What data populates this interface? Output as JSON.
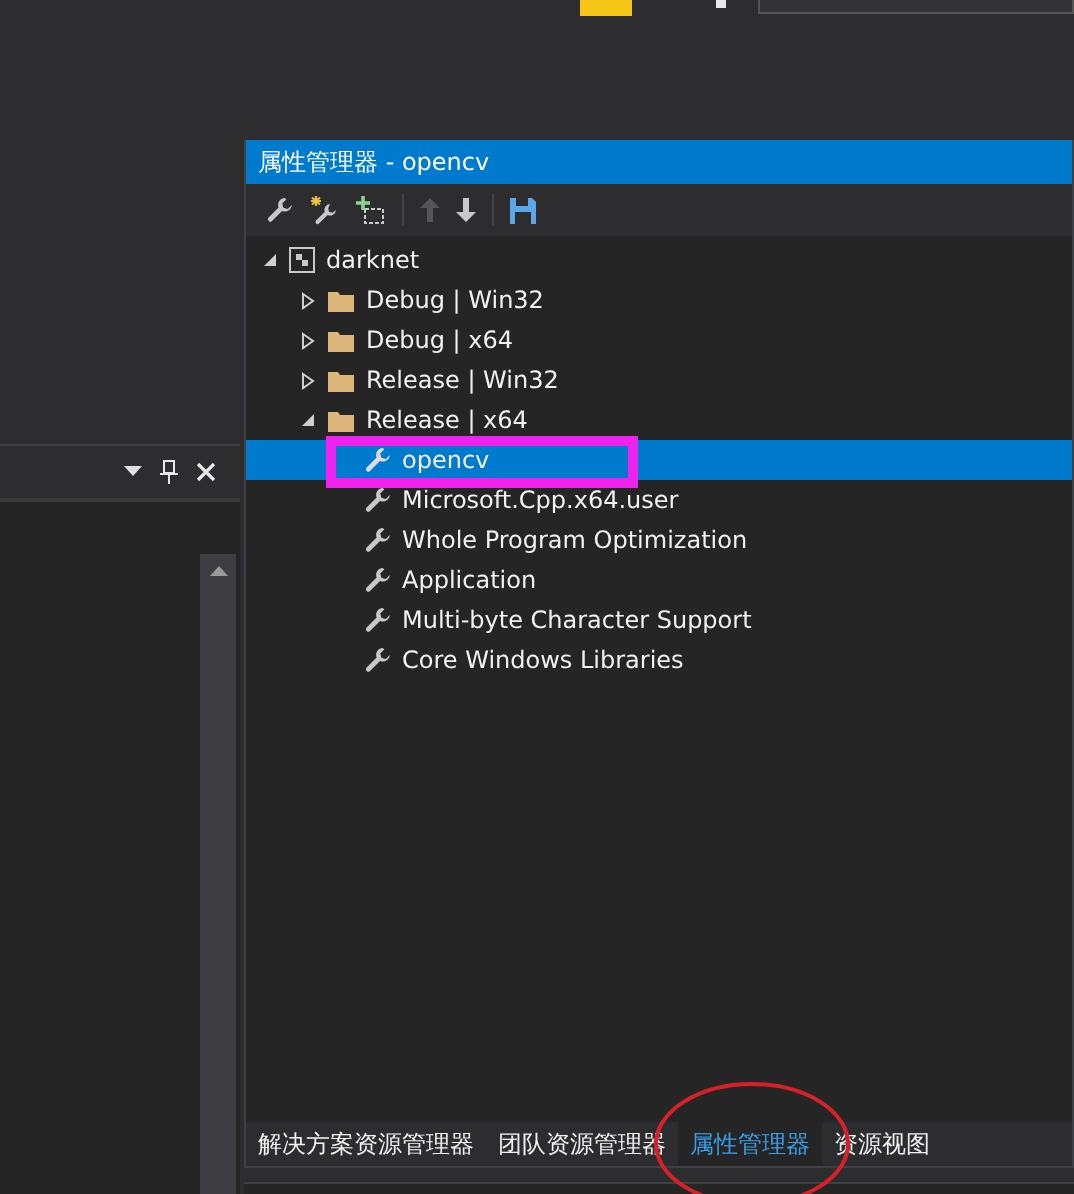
{
  "panel": {
    "title": "属性管理器 - opencv",
    "toolbar": [
      [
        {
          "kind": "wrench",
          "disabled": false
        },
        {
          "kind": "wand",
          "disabled": false
        },
        {
          "kind": "add",
          "disabled": false
        }
      ],
      [
        {
          "kind": "up",
          "disabled": true
        },
        {
          "kind": "down",
          "disabled": false
        }
      ],
      [
        {
          "kind": "save",
          "disabled": false
        }
      ]
    ],
    "tree": [
      {
        "label": "darknet",
        "kind": "project",
        "expanded": true,
        "selected": false,
        "children": [
          {
            "label": "Debug | Win32",
            "kind": "config",
            "expanded": false,
            "selected": false
          },
          {
            "label": "Debug | x64",
            "kind": "config",
            "expanded": false,
            "selected": false
          },
          {
            "label": "Release | Win32",
            "kind": "config",
            "expanded": false,
            "selected": false
          },
          {
            "label": "Release | x64",
            "kind": "config",
            "expanded": true,
            "selected": false,
            "children": [
              {
                "label": "opencv",
                "kind": "sheet",
                "selected": true
              },
              {
                "label": "Microsoft.Cpp.x64.user",
                "kind": "sheet",
                "selected": false
              },
              {
                "label": "Whole Program Optimization",
                "kind": "sheet",
                "selected": false
              },
              {
                "label": "Application",
                "kind": "sheet",
                "selected": false
              },
              {
                "label": "Multi-byte Character Support",
                "kind": "sheet",
                "selected": false
              },
              {
                "label": "Core Windows Libraries",
                "kind": "sheet",
                "selected": false
              }
            ]
          }
        ]
      }
    ]
  },
  "tabs": [
    {
      "label": "解决方案资源管理器",
      "selected": false
    },
    {
      "label": "团队资源管理器",
      "selected": false
    },
    {
      "label": "属性管理器",
      "selected": true
    },
    {
      "label": "资源视图",
      "selected": false
    }
  ]
}
